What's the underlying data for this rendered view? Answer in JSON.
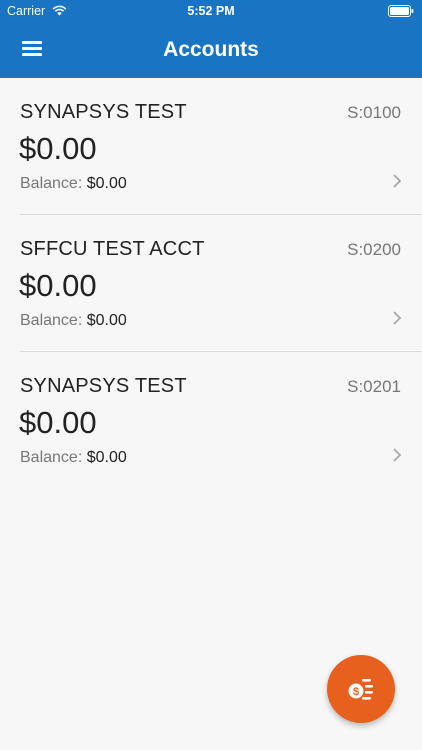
{
  "status_bar": {
    "carrier": "Carrier",
    "time": "5:52 PM"
  },
  "nav": {
    "title": "Accounts"
  },
  "accounts": [
    {
      "name": "SYNAPSYS TEST",
      "id": "S:0100",
      "amount": "$0.00",
      "balance_label": "Balance:",
      "balance_value": "$0.00"
    },
    {
      "name": "SFFCU TEST ACCT",
      "id": "S:0200",
      "amount": "$0.00",
      "balance_label": "Balance:",
      "balance_value": "$0.00"
    },
    {
      "name": "SYNAPSYS TEST",
      "id": "S:0201",
      "amount": "$0.00",
      "balance_label": "Balance:",
      "balance_value": "$0.00"
    }
  ],
  "colors": {
    "header": "#1a74c4",
    "fab": "#e8601e",
    "background": "#f7f7f7"
  },
  "icons": {
    "menu": "menu-icon",
    "chevron": "chevron-right-icon",
    "fab": "transfer-money-icon"
  }
}
